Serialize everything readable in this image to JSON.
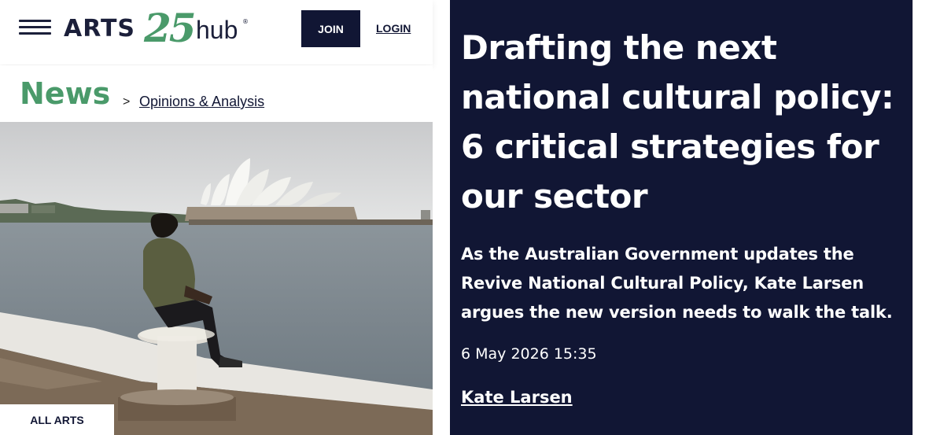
{
  "header": {
    "logo_text": "ARTS",
    "logo_number": "25",
    "logo_suffix": "hub",
    "logo_mark": "®",
    "join_label": "JOIN",
    "login_label": "LOGIN",
    "menu_icon": "hamburger-menu-icon"
  },
  "breadcrumb": {
    "section": "News",
    "separator": ">",
    "category": "Opinions & Analysis"
  },
  "image": {
    "description_icon": "sydney-opera-house-photo",
    "tag_label": "ALL ARTS"
  },
  "article": {
    "headline": "Drafting the next national cultural policy: 6 critical strategies for our sector",
    "standfirst": "As the Australian Government updates the Revive National Cultural Policy, Kate Larsen argues the new version needs to walk the talk.",
    "date": "6 May 2026 15:35",
    "author": "Kate Larsen"
  },
  "colors": {
    "brand_navy": "#111634",
    "brand_green": "#4a9a6a",
    "background": "#ffffff"
  }
}
